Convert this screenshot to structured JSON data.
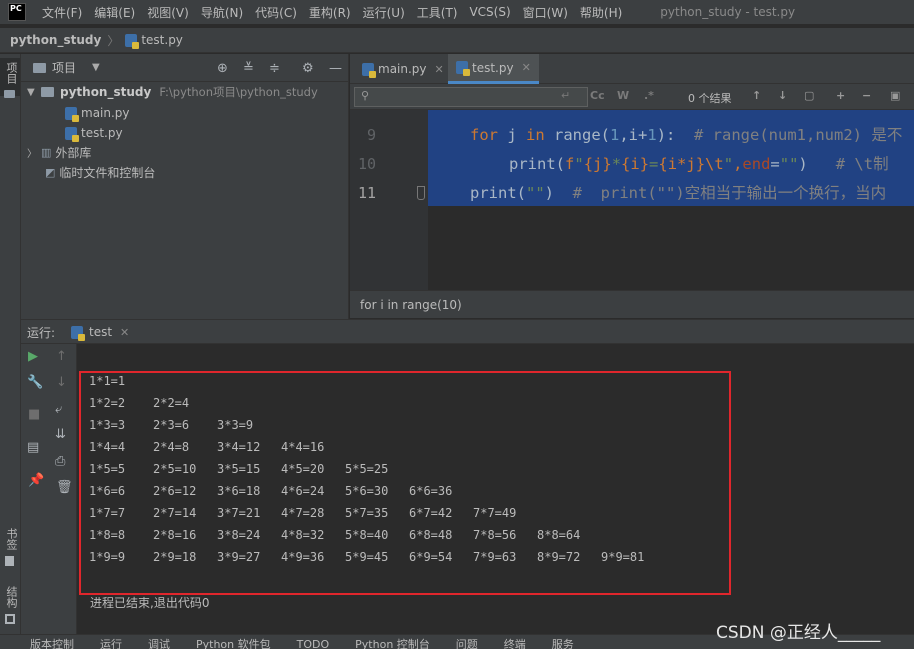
{
  "app": {
    "logo": "PC",
    "window_title": "python_study - test.py"
  },
  "menu": [
    "文件(F)",
    "编辑(E)",
    "视图(V)",
    "导航(N)",
    "代码(C)",
    "重构(R)",
    "运行(U)",
    "工具(T)",
    "VCS(S)",
    "窗口(W)",
    "帮助(H)"
  ],
  "breadcrumb": {
    "project": "python_study",
    "file": "test.py"
  },
  "left_stripe": {
    "project": "项目",
    "bookmarks": "书签",
    "structure": "结构"
  },
  "project_panel": {
    "title": "项目",
    "root_name": "python_study",
    "root_path": "F:\\python项目\\python_study",
    "files": [
      "main.py",
      "test.py"
    ],
    "external_libs": "外部库",
    "scratches": "临时文件和控制台"
  },
  "editor": {
    "tabs": [
      {
        "label": "main.py"
      },
      {
        "label": "test.py"
      }
    ],
    "find_results": "0 个结果",
    "find_match_case": "Cc",
    "find_word": "W",
    "find_regex": ".*",
    "lines": [
      "9",
      "10",
      "11"
    ],
    "code": {
      "line9_for": "for",
      "line9_j": " j ",
      "line9_in": "in",
      "line9_range": " range(",
      "line9_one": "1",
      "line9_rest": ",i+",
      "line9_one2": "1",
      "line9_close": "):  ",
      "line9_comment": "# range(num1,num2) 是不",
      "line10_print": "print(",
      "line10_f": "f",
      "line10_q1": "\"",
      "line10_b1": "{j}",
      "line10_t1": "*",
      "line10_b2": "{i}",
      "line10_t2": "=",
      "line10_b3": "{i*j}",
      "line10_esc": "\\t",
      "line10_q2": "\"",
      "line10_comma": ",",
      "line10_end": "end",
      "line10_eq": "=",
      "line10_estr": "\"\"",
      "line10_close": ")   ",
      "line10_comment": "# \\t制",
      "line11_print": "print(",
      "line11_str": "\"\"",
      "line11_close": ")  ",
      "line11_comment": "#  print(\"\")空相当于输出一个换行，当内"
    },
    "status": "for i in range(10)"
  },
  "run_panel": {
    "label": "运行:",
    "tab": "test",
    "output": [
      [
        "1*1=1"
      ],
      [
        "1*2=2",
        "2*2=4"
      ],
      [
        "1*3=3",
        "2*3=6",
        "3*3=9"
      ],
      [
        "1*4=4",
        "2*4=8",
        "3*4=12",
        "4*4=16"
      ],
      [
        "1*5=5",
        "2*5=10",
        "3*5=15",
        "4*5=20",
        "5*5=25"
      ],
      [
        "1*6=6",
        "2*6=12",
        "3*6=18",
        "4*6=24",
        "5*6=30",
        "6*6=36"
      ],
      [
        "1*7=7",
        "2*7=14",
        "3*7=21",
        "4*7=28",
        "5*7=35",
        "6*7=42",
        "7*7=49"
      ],
      [
        "1*8=8",
        "2*8=16",
        "3*8=24",
        "4*8=32",
        "5*8=40",
        "6*8=48",
        "7*8=56",
        "8*8=64"
      ],
      [
        "1*9=9",
        "2*9=18",
        "3*9=27",
        "4*9=36",
        "5*9=45",
        "6*9=54",
        "7*9=63",
        "8*9=72",
        "9*9=81"
      ]
    ],
    "exit_message": "进程已结束,退出代码0"
  },
  "bottom_tabs": [
    "版本控制",
    "运行",
    "调试",
    "Python 软件包",
    "TODO",
    "Python 控制台",
    "问题",
    "终端",
    "服务"
  ],
  "watermark": "CSDN @正经人_____",
  "colors": {
    "selection": "#214283",
    "highlight_box": "#e0262c",
    "keyword": "#cc7832",
    "string": "#6a8759",
    "number": "#6897bb",
    "comment": "#808080",
    "tab_accent": "#4a88c7"
  }
}
